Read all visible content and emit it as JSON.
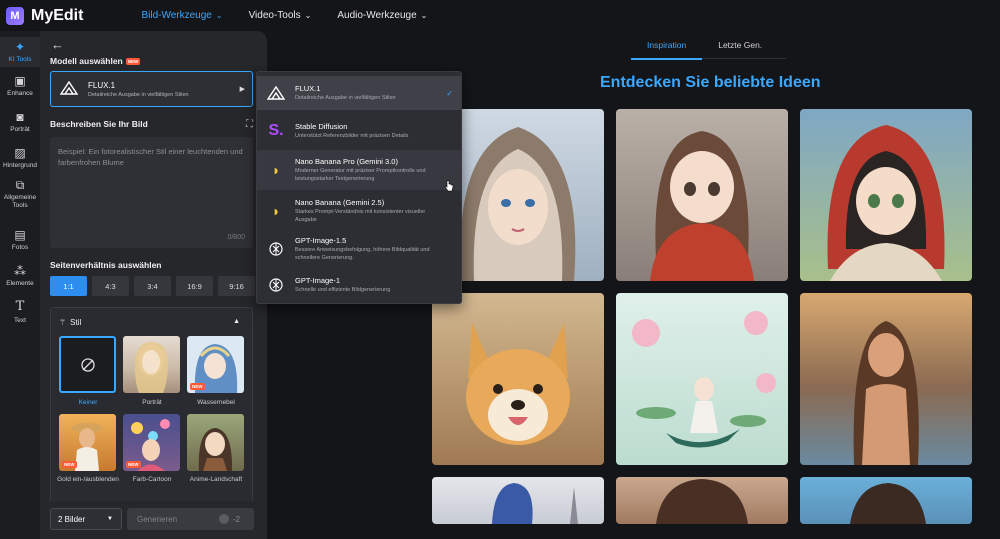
{
  "app": {
    "logo_letter": "M",
    "name": "MyEdit"
  },
  "topnav": [
    {
      "label": "Bild-Werkzeuge",
      "active": true
    },
    {
      "label": "Video-Tools",
      "active": false
    },
    {
      "label": "Audio-Werkzeuge",
      "active": false
    }
  ],
  "rail": [
    {
      "label": "KI Tools",
      "icon": "magic-wand-icon",
      "active": true
    },
    {
      "label": "Enhance",
      "icon": "enhance-icon"
    },
    {
      "label": "Porträt",
      "icon": "portrait-icon"
    },
    {
      "label": "Hintergrund",
      "icon": "background-icon"
    },
    {
      "label": "Allgemeine Tools",
      "icon": "tools-icon"
    },
    {
      "label": "Fotos",
      "icon": "photos-icon"
    },
    {
      "label": "Elemente",
      "icon": "elements-icon"
    },
    {
      "label": "Text",
      "icon": "text-icon"
    }
  ],
  "panel": {
    "model_label": "Modell auswählen",
    "new_badge": "NEW",
    "selected_model": {
      "name": "FLUX.1",
      "desc": "Detailreiche Ausgabe in vielfältigen Stilen"
    },
    "describe_label": "Beschreiben Sie Ihr Bild",
    "prompt_placeholder": "Beispiel: Ein fotorealistischer Stil einer leuchtenden und farbenfrohen Blume",
    "char_count": "0/800",
    "ratio_label": "Seitenverhältnis auswählen",
    "ratios": [
      "1:1",
      "4:3",
      "3:4",
      "16:9",
      "9:16"
    ],
    "style_label": "Stil",
    "styles": [
      {
        "label": "Keiner",
        "selected": true
      },
      {
        "label": "Porträt"
      },
      {
        "label": "Wassernebel",
        "new": true
      },
      {
        "label": "Gold ein-/ausblenden",
        "new": true
      },
      {
        "label": "Farb-Cartoon",
        "new": true
      },
      {
        "label": "Anime-Landschaft"
      }
    ],
    "count_value": "2 Bilder",
    "generate_label": "Generieren",
    "generate_cost": "-2"
  },
  "dropdown": [
    {
      "name": "FLUX.1",
      "desc": "Detailreiche Ausgabe in vielfältigen Stilen",
      "selected": true
    },
    {
      "name": "Stable Diffusion",
      "desc": "Unterstützt Referenzbilder mit präzisen Details"
    },
    {
      "name": "Nano Banana Pro (Gemini 3.0)",
      "desc": "Moderner Generator mit präziser Promptkontrolle und leistungsstarker Textgenerierung"
    },
    {
      "name": "Nano Banana (Gemini 2.5)",
      "desc": "Starkes Prompt-Verständnis mit konsistenter visueller Ausgabe"
    },
    {
      "name": "GPT-Image-1.5",
      "desc": "Bessere Anweisungsbefolgung, höhere Bildqualität und schnellere Generierung."
    },
    {
      "name": "GPT-Image-1",
      "desc": "Schnelle und effiziente Bildgenerierung"
    }
  ],
  "main": {
    "tabs": [
      {
        "label": "Inspiration",
        "active": true
      },
      {
        "label": "Letzte Gen."
      }
    ],
    "heading": "Entdecken Sie beliebte Ideen"
  },
  "colors": {
    "accent": "#3aa8ff",
    "new_badge": "#ff5a36",
    "panel": "#26272b",
    "background": "#141518"
  }
}
